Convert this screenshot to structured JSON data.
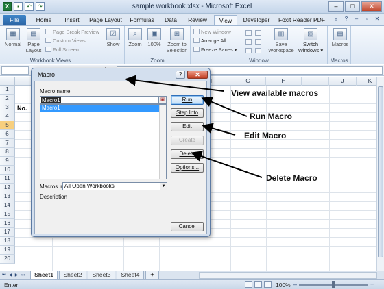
{
  "window": {
    "title": "sample workbook.xlsx  -  Microsoft Excel",
    "app_icon": "excel-icon",
    "controls": [
      "–",
      "□",
      "✕"
    ]
  },
  "ribbon_tabs": [
    "File",
    "Home",
    "Insert",
    "Page Layout",
    "Formulas",
    "Data",
    "Review",
    "View",
    "Developer",
    "Foxit Reader PDF"
  ],
  "active_tab": "View",
  "ribbon": {
    "workbook_views": {
      "label": "Workbook Views",
      "normal": "Normal",
      "page_layout_1": "Page",
      "page_layout_2": "Layout",
      "page_break": "Page Break Preview",
      "custom_views": "Custom Views",
      "full_screen": "Full Screen"
    },
    "show": {
      "label": "Show"
    },
    "zoom": {
      "label": "Zoom",
      "zoom": "Zoom",
      "hundred": "100%",
      "selection_1": "Zoom to",
      "selection_2": "Selection"
    },
    "window": {
      "label": "Window",
      "new_window": "New Window",
      "arrange_all": "Arrange All",
      "freeze_panes": "Freeze Panes",
      "save_ws_1": "Save",
      "save_ws_2": "Workspace",
      "switch_1": "Switch",
      "switch_2": "Windows"
    },
    "macros": {
      "label": "Macros",
      "button": "Macros"
    }
  },
  "grid": {
    "columns": [
      "A",
      "B",
      "C",
      "D",
      "E",
      "F",
      "G",
      "H",
      "I",
      "J",
      "K"
    ],
    "rows": [
      "1",
      "2",
      "3",
      "4",
      "5",
      "6",
      "7",
      "8",
      "9",
      "10",
      "11",
      "12",
      "13",
      "14",
      "15",
      "16",
      "17",
      "18",
      "19",
      "20"
    ],
    "selected_row": "5",
    "cell_text": "No."
  },
  "sheets": [
    "Sheet1",
    "Sheet2",
    "Sheet3",
    "Sheet4"
  ],
  "active_sheet": "Sheet1",
  "status": {
    "mode": "Enter",
    "zoom": "100%",
    "zoom_level_pct": 100
  },
  "macro_dialog": {
    "title": "Macro",
    "help": "?",
    "close": "✕",
    "name_label": "Macro name:",
    "name_value": "Macro1",
    "list": [
      "Macro1"
    ],
    "buttons": {
      "run": "Run",
      "step_into": "Step Into",
      "edit": "Edit",
      "create": "Create",
      "delete": "Delete",
      "options": "Options...",
      "cancel": "Cancel"
    },
    "macros_in_label": "Macros in:",
    "macros_in_value": "All Open Workbooks",
    "description_label": "Description"
  },
  "annotations": {
    "view": "View available macros",
    "run": "Run Macro",
    "edit": "Edit Macro",
    "delete": "Delete Macro"
  }
}
